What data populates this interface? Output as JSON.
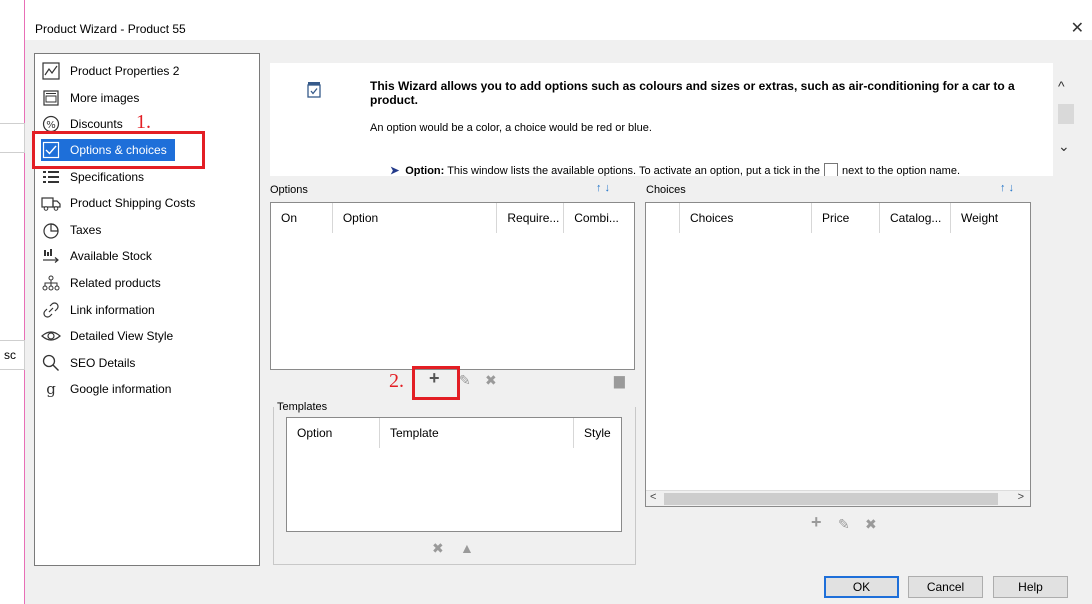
{
  "window": {
    "title": "Product Wizard - Product 55",
    "close_glyph": "✕"
  },
  "nav": {
    "items": [
      {
        "label": "Product Properties 2",
        "icon": "chart-icon"
      },
      {
        "label": "More images",
        "icon": "image-icon"
      },
      {
        "label": "Discounts",
        "icon": "percent-icon"
      },
      {
        "label": "Options & choices",
        "icon": "checkbox-icon",
        "selected": true
      },
      {
        "label": "Specifications",
        "icon": "list-icon"
      },
      {
        "label": "Product Shipping Costs",
        "icon": "truck-icon"
      },
      {
        "label": "Taxes",
        "icon": "pie-icon"
      },
      {
        "label": "Available Stock",
        "icon": "stock-icon"
      },
      {
        "label": "Related products",
        "icon": "hierarchy-icon"
      },
      {
        "label": "Link information",
        "icon": "link-icon"
      },
      {
        "label": "Detailed View Style",
        "icon": "eye-icon"
      },
      {
        "label": "SEO Details",
        "icon": "search-icon"
      },
      {
        "label": "Google information",
        "icon": "google-icon"
      }
    ]
  },
  "annotations": {
    "step1": "1.",
    "step2": "2.",
    "color": "#e31e24"
  },
  "wizard": {
    "title": "This Wizard allows you to add options such as colours and sizes or extras, such as air-conditioning for a car to a product.",
    "subtitle": "An option would be a color, a choice would be red or blue.",
    "option_label": "Option:",
    "option_text_a": "This window lists the available options. To activate an option, put a tick in the",
    "option_text_b": "next to the option name."
  },
  "options_panel": {
    "label": "Options",
    "columns": [
      "On",
      "Option",
      "Require...",
      "Combi..."
    ]
  },
  "choices_panel": {
    "label": "Choices",
    "columns": [
      "",
      "Choices",
      "Price",
      "Catalog...",
      "Weight"
    ]
  },
  "templates_panel": {
    "label": "Templates",
    "columns": [
      "Option",
      "Template",
      "Style"
    ]
  },
  "sort_arrows": "↑↓",
  "buttons": {
    "ok": "OK",
    "cancel": "Cancel",
    "help": "Help"
  },
  "accent": "#1e6fd9"
}
